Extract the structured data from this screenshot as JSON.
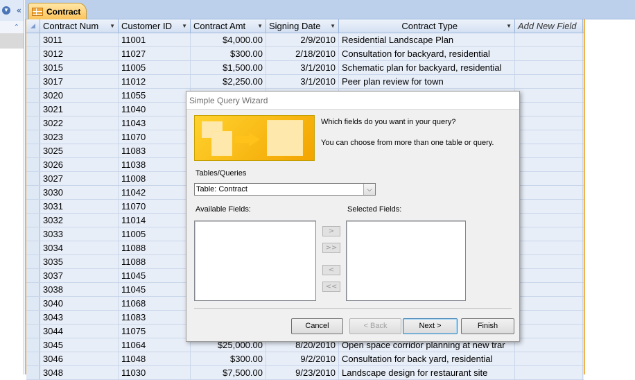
{
  "nav": {
    "dropdown_icon": "chevron-down-icon",
    "collapse_glyph": "«",
    "expand_glyph": "⌃"
  },
  "document_tab": {
    "label": "Contract",
    "icon": "table-icon"
  },
  "table": {
    "columns": [
      "Contract Num",
      "Customer ID",
      "Contract Amt",
      "Signing Date",
      "Contract Type",
      "Add New Field"
    ],
    "rows": [
      [
        "3011",
        "11001",
        "$4,000.00",
        "2/9/2010",
        "Residential Landscape Plan"
      ],
      [
        "3012",
        "11027",
        "$300.00",
        "2/18/2010",
        "Consultation for backyard, residential"
      ],
      [
        "3015",
        "11005",
        "$1,500.00",
        "3/1/2010",
        "Schematic plan for backyard, residential"
      ],
      [
        "3017",
        "11012",
        "$2,250.00",
        "3/1/2010",
        "Peer plan review for town"
      ],
      [
        "3020",
        "11055",
        "",
        "",
        ""
      ],
      [
        "3021",
        "11040",
        "",
        "",
        ""
      ],
      [
        "3022",
        "11043",
        "",
        "",
        ""
      ],
      [
        "3023",
        "11070",
        "",
        "",
        ""
      ],
      [
        "3025",
        "11083",
        "",
        "",
        ""
      ],
      [
        "3026",
        "11038",
        "",
        "",
        ""
      ],
      [
        "3027",
        "11008",
        "",
        "",
        ""
      ],
      [
        "3030",
        "11042",
        "",
        "",
        ""
      ],
      [
        "3031",
        "11070",
        "",
        "",
        ""
      ],
      [
        "3032",
        "11014",
        "",
        "",
        ""
      ],
      [
        "3033",
        "11005",
        "",
        "",
        ""
      ],
      [
        "3034",
        "11088",
        "",
        "",
        ""
      ],
      [
        "3035",
        "11088",
        "",
        "",
        ""
      ],
      [
        "3037",
        "11045",
        "",
        "",
        ""
      ],
      [
        "3038",
        "11045",
        "",
        "",
        ""
      ],
      [
        "3040",
        "11068",
        "",
        "",
        ""
      ],
      [
        "3043",
        "11083",
        "",
        "",
        ""
      ],
      [
        "3044",
        "11075",
        "",
        "",
        ""
      ],
      [
        "3045",
        "11064",
        "$25,000.00",
        "8/20/2010",
        "Open space corridor planning at new trar"
      ],
      [
        "3046",
        "11048",
        "$300.00",
        "9/2/2010",
        "Consultation for back yard, residential"
      ],
      [
        "3048",
        "11030",
        "$7,500.00",
        "9/23/2010",
        "Landscape design for restaurant site"
      ]
    ]
  },
  "dialog": {
    "title": "Simple Query Wizard",
    "question": "Which fields do you want in your query?",
    "hint": "You can choose from more than one table or query.",
    "tables_label": "Tables/Queries",
    "tables_value": "Table: Contract",
    "available_label": "Available Fields:",
    "selected_label": "Selected Fields:",
    "move_buttons": [
      ">",
      ">>",
      "<",
      "<<"
    ],
    "buttons": {
      "cancel": "Cancel",
      "back": "< Back",
      "next": "Next >",
      "finish": "Finish"
    }
  }
}
